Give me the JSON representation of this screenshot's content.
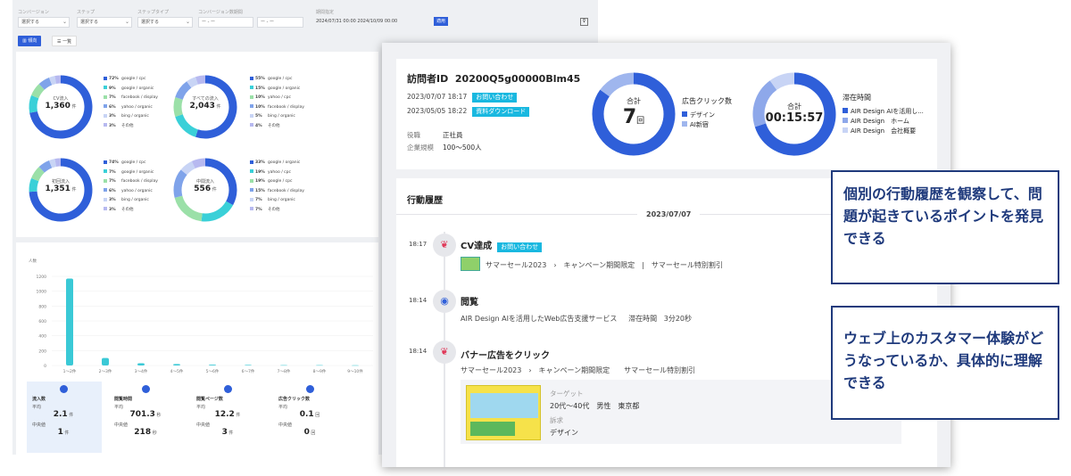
{
  "filters": [
    {
      "label": "コンバージョン",
      "value": "選択する"
    },
    {
      "label": "ステップ",
      "value": "選択する"
    },
    {
      "label": "ステップタイプ",
      "value": "選択する"
    },
    {
      "label": "コンバージョン数期間",
      "value": "ー - ー"
    },
    {
      "label": "",
      "value": "ー - ー"
    },
    {
      "label": "期間指定",
      "value": "2024/07/31 00:00 2024/10/09 00:00"
    }
  ],
  "apply_label": "適用",
  "tabs": {
    "active": "傾向",
    "other": "一覧"
  },
  "donuts": [
    {
      "label": "CV流入",
      "value": "1,360",
      "unit": "件",
      "segments": [
        72,
        9,
        7,
        6,
        3,
        3
      ],
      "legend": [
        [
          "72%",
          "google / cpc"
        ],
        [
          "9%",
          "google / organic"
        ],
        [
          "7%",
          "facebook / display"
        ],
        [
          "6%",
          "yahoo / organic"
        ],
        [
          "3%",
          "bing / organic"
        ],
        [
          "3%",
          "その他"
        ]
      ]
    },
    {
      "label": "すべての流入",
      "value": "2,043",
      "unit": "件",
      "segments": [
        55,
        15,
        10,
        10,
        5,
        5
      ],
      "legend": [
        [
          "55%",
          "google / cpc"
        ],
        [
          "15%",
          "google / organic"
        ],
        [
          "10%",
          "yahoo / cpc"
        ],
        [
          "10%",
          "facebook / display"
        ],
        [
          "5%",
          "bing / organic"
        ],
        [
          "4%",
          "その他"
        ]
      ]
    },
    {
      "label": "初回流入",
      "value": "1,351",
      "unit": "件",
      "segments": [
        74,
        7,
        7,
        6,
        3,
        3
      ],
      "legend": [
        [
          "74%",
          "google / cpc"
        ],
        [
          "7%",
          "google / organic"
        ],
        [
          "7%",
          "facebook / display"
        ],
        [
          "6%",
          "yahoo / organic"
        ],
        [
          "3%",
          "bing / organic"
        ],
        [
          "3%",
          "その他"
        ]
      ]
    },
    {
      "label": "中間流入",
      "value": "556",
      "unit": "件",
      "segments": [
        33,
        19,
        19,
        15,
        7,
        7
      ],
      "legend": [
        [
          "33%",
          "google / organic"
        ],
        [
          "19%",
          "yahoo / cpc"
        ],
        [
          "19%",
          "google / cpc"
        ],
        [
          "15%",
          "facebook / display"
        ],
        [
          "7%",
          "bing / organic"
        ],
        [
          "7%",
          "その他"
        ]
      ]
    }
  ],
  "bar_chart": {
    "type": "bar",
    "ylabel": "人数",
    "yticks": [
      "1200",
      "1000",
      "800",
      "600",
      "400",
      "200",
      "0"
    ],
    "ylim": [
      0,
      1200
    ],
    "categories": [
      "1〜2件",
      "2〜3件",
      "3〜4件",
      "4〜5件",
      "5〜6件",
      "6〜7件",
      "7〜8件",
      "8〜9件",
      "9〜10件"
    ],
    "values": [
      1170,
      100,
      30,
      20,
      10,
      8,
      5,
      4,
      3
    ]
  },
  "stats": [
    {
      "title": "流入数",
      "avg_label": "平均",
      "avg": "2.1",
      "avg_unit": "件",
      "med_label": "中央値",
      "med": "1",
      "med_unit": "件"
    },
    {
      "title": "閲覧時間",
      "avg_label": "平均",
      "avg": "701.3",
      "avg_unit": "秒",
      "med_label": "中央値",
      "med": "218",
      "med_unit": "秒"
    },
    {
      "title": "閲覧ページ数",
      "avg_label": "平均",
      "avg": "12.2",
      "avg_unit": "件",
      "med_label": "中央値",
      "med": "3",
      "med_unit": "件"
    },
    {
      "title": "広告クリック数",
      "avg_label": "平均",
      "avg": "0.1",
      "avg_unit": "回",
      "med_label": "中央値",
      "med": "0",
      "med_unit": "回"
    }
  ],
  "visitor": {
    "id_label": "訪問者ID",
    "id": "20200Q5g00000Blm45",
    "events": [
      {
        "date": "2023/07/07 18:17",
        "tag": "お問い合わせ"
      },
      {
        "date": "2023/05/05 18:22",
        "tag": "資料ダウンロード"
      }
    ],
    "role_label": "役職",
    "role": "正社員",
    "size_label": "企業規模",
    "size": "100〜500人"
  },
  "ad_click": {
    "center_label": "合計",
    "value": "7",
    "unit": "回",
    "title": "広告クリック数",
    "legend": [
      "デザイン",
      "AI新宿"
    ],
    "segments": [
      85,
      15
    ]
  },
  "stay_time": {
    "center_label": "合計",
    "value": "00:15:57",
    "title": "滞在時間",
    "legend": [
      "AIR Design AIを活用し...",
      "AIR Design　ホーム",
      "AIR Design　会社概要"
    ],
    "segments": [
      70,
      20,
      10
    ]
  },
  "history": {
    "title": "行動履歴",
    "date": "2023/07/07",
    "items": [
      {
        "time": "18:17",
        "title": "CV達成",
        "tag": "お問い合わせ",
        "text": "サマーセール2023　›　キャンペーン期間限定　|　サマーセール特別割引"
      },
      {
        "time": "18:14",
        "title": "閲覧",
        "text": "AIR Design AIを活用したWeb広告支援サービス",
        "extra_label": "滞在時間",
        "extra": "3分20秒"
      },
      {
        "time": "18:14",
        "title": "バナー広告をクリック",
        "text": "サマーセール2023　›　キャンペーン期間限定　　サマーセール特別割引",
        "target_label": "ターゲット",
        "target": "20代〜40代　男性　東京都",
        "appeal_label": "訴求",
        "appeal": "デザイン"
      }
    ]
  },
  "callouts": [
    "個別の行動履歴を観察して、問題が起きているポイントを発見できる",
    "ウェブ上のカスタマー体験がどうなっているか、具体的に理解できる"
  ],
  "colors": {
    "primary": "#2f5fd9",
    "light": "#7fa3ea",
    "pale": "#c8d4f5",
    "cyan": "#3ad0d8",
    "green": "#9be0a8",
    "navy": "#1f3a7c",
    "tag": "#19b8e0"
  }
}
